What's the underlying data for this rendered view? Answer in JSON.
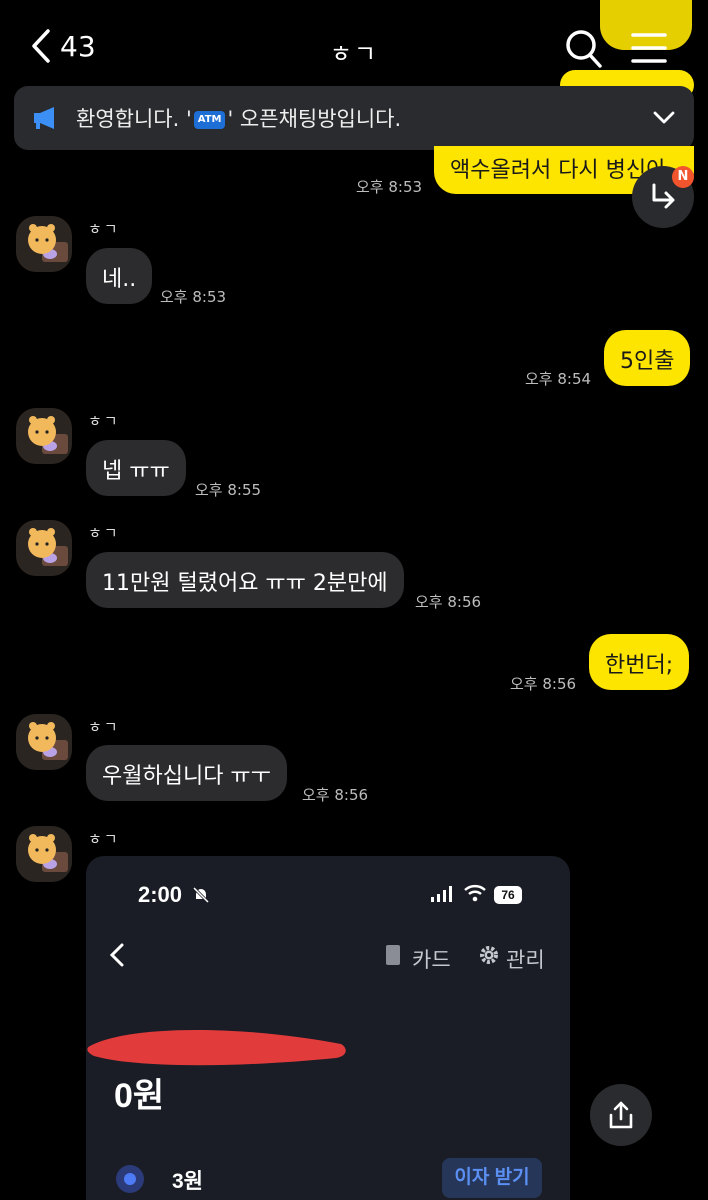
{
  "header": {
    "back_count": "43",
    "title": "ㅎㄱ"
  },
  "notice": {
    "text_before": "환영합니다. '",
    "badge": "ATM",
    "text_after": "' 오픈채팅방입니다."
  },
  "top_partial": {
    "bubble": "액수올려서 다시 병신아",
    "time": "오후 8:53"
  },
  "fab_badge": "N",
  "messages": [
    {
      "sender": "ㅎㄱ",
      "text": "네..",
      "time": "오후 8:53"
    },
    {
      "text": "5인출",
      "time": "오후 8:54"
    },
    {
      "sender": "ㅎㄱ",
      "text": "넵 ㅠㅠ",
      "time": "오후 8:55"
    },
    {
      "sender": "ㅎㄱ",
      "text": "11만원 털렸어요 ㅠㅠ 2분만에",
      "time": "오후 8:56"
    },
    {
      "text": "한번더;",
      "time": "오후 8:56"
    },
    {
      "sender": "ㅎㄱ",
      "text": "우월하십니다 ㅠㅜ",
      "time": "오후 8:56"
    },
    {
      "sender": "ㅎㄱ"
    }
  ],
  "shot": {
    "clock": "2:00",
    "battery": "76",
    "card_label": "카드",
    "manage_label": "관리",
    "balance": "0원",
    "sub_amount": "3원",
    "interest_button": "이자 받기"
  }
}
